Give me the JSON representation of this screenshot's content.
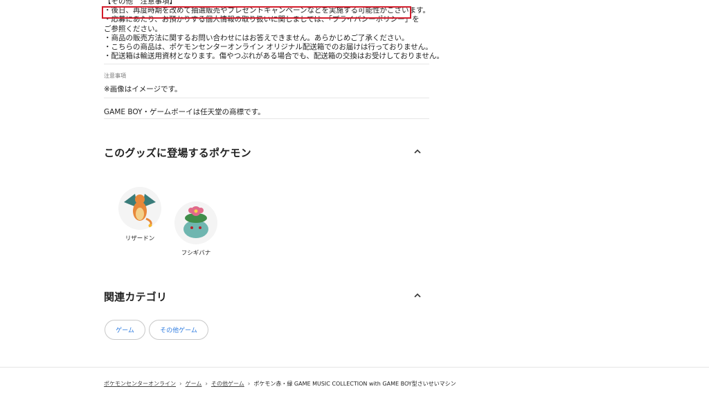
{
  "notes": {
    "heading": "【その他　注意事項】",
    "line1": "・後日、再度時期を改めて抽選販売やプレゼントキャンペーンなどを実施する可能性がございます。",
    "line2": "・応募にあたり、お預かりする個人情報の取り扱いに関しましては、「プライバシーポリシー」をご参照ください。",
    "line3": "・商品の販売方法に関するお問い合わせにはお答えできません。あらかじめご了承ください。",
    "line4": "・こちらの商品は、ポケモンセンターオンライン オリジナル配送箱でのお届けは行っておりません。",
    "line5": "・配送箱は輸送用資材となります。傷やつぶれがある場合でも、配送箱の交換はお受けしておりません。"
  },
  "caution": {
    "label": "注意事項",
    "image_note": "※画像はイメージです。",
    "trademark": "GAME BOY・ゲームボーイは任天堂の商標です。"
  },
  "pokemon_section": {
    "title": "このグッズに登場するポケモン",
    "items": [
      {
        "name": "リザードン",
        "icon": "charizard-image"
      },
      {
        "name": "フシギバナ",
        "icon": "venusaur-image"
      }
    ]
  },
  "category_section": {
    "title": "関連カテゴリ",
    "chips": [
      "ゲーム",
      "その他ゲーム"
    ]
  },
  "breadcrumb": {
    "items": [
      "ポケモンセンターオンライン",
      "ゲーム",
      "その他ゲーム"
    ],
    "current": "ポケモン赤・緑 GAME MUSIC COLLECTION with GAME BOY型さいせいマシン"
  },
  "colors": {
    "highlight_box": "#d21b2a",
    "link_chip_text": "#2f7de1",
    "charizard_body": "#e8883a",
    "venusaur_body": "#6fb6b0"
  }
}
